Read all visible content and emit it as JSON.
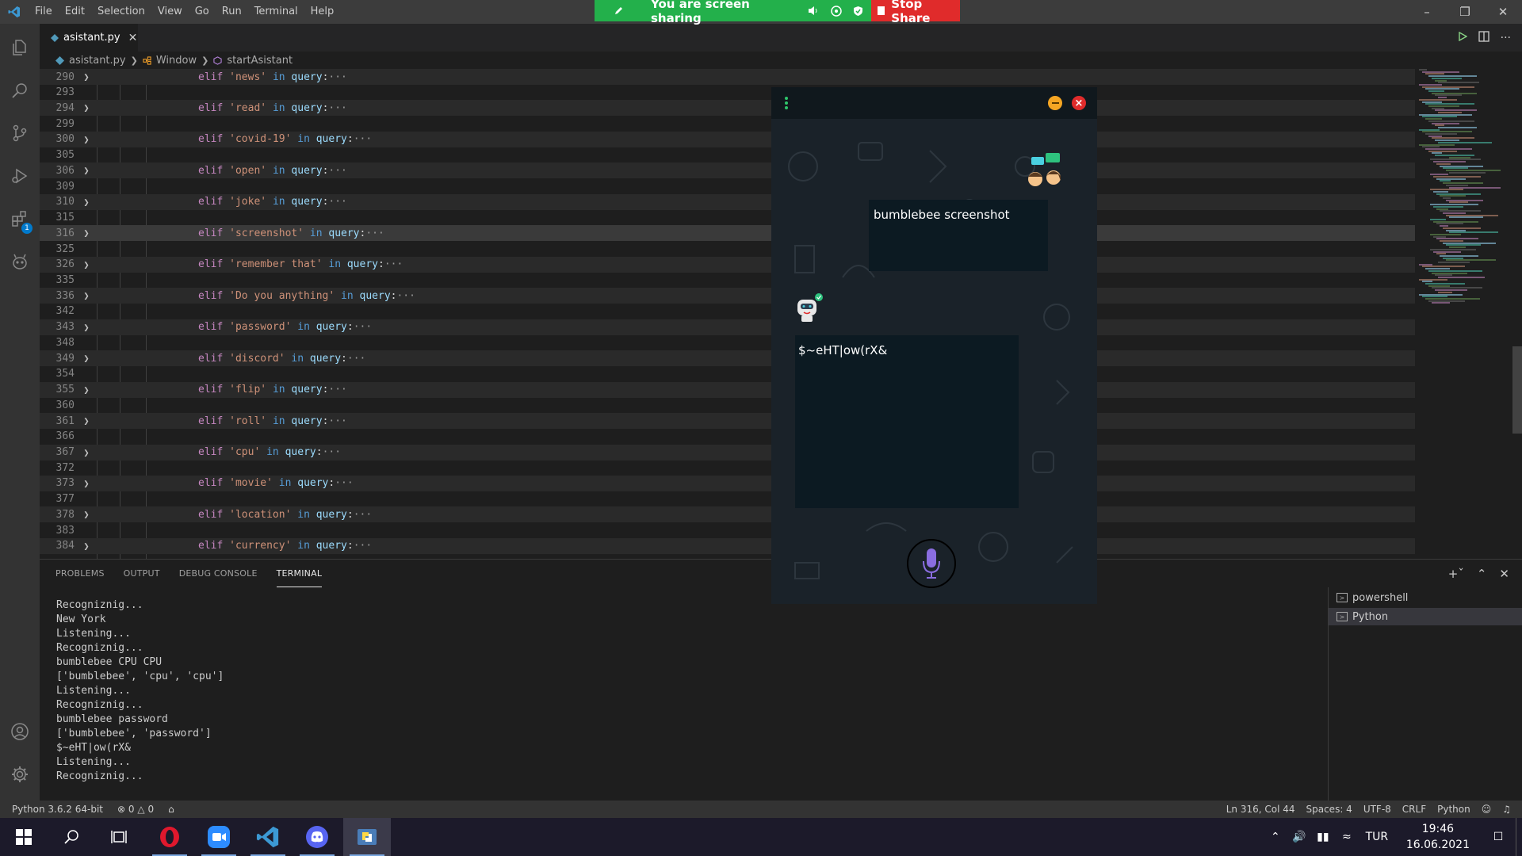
{
  "menu": [
    "File",
    "Edit",
    "Selection",
    "View",
    "Go",
    "Run",
    "Terminal",
    "Help"
  ],
  "share": {
    "message": "You are screen sharing",
    "stop_label": "Stop Share"
  },
  "tab": {
    "filename": "asistant.py"
  },
  "breadcrumb": {
    "file": "asistant.py",
    "class": "Window",
    "method": "startAsistant"
  },
  "activity": {
    "extensions_badge": "1"
  },
  "editor": {
    "lines": [
      {
        "n": "290",
        "fold": true,
        "kw": "elif",
        "str": "'news'",
        "in": "in",
        "var": "query",
        "rest": ":",
        "ell": "···"
      },
      {
        "n": "293"
      },
      {
        "n": "294",
        "fold": true,
        "kw": "elif",
        "str": "'read'",
        "in": "in",
        "var": "query",
        "rest": ":",
        "ell": "···"
      },
      {
        "n": "299"
      },
      {
        "n": "300",
        "fold": true,
        "kw": "elif",
        "str": "'covid-19'",
        "in": "in",
        "var": "query",
        "rest": ":",
        "ell": "···"
      },
      {
        "n": "305"
      },
      {
        "n": "306",
        "fold": true,
        "kw": "elif",
        "str": "'open'",
        "in": "in",
        "var": "query",
        "rest": ":",
        "ell": "···"
      },
      {
        "n": "309"
      },
      {
        "n": "310",
        "fold": true,
        "kw": "elif",
        "str": "'joke'",
        "in": "in",
        "var": "query",
        "rest": ":",
        "ell": "···"
      },
      {
        "n": "315"
      },
      {
        "n": "316",
        "fold": true,
        "current": true,
        "kw": "elif",
        "str": "'screenshot'",
        "in": "in",
        "var": "query",
        "rest": ":",
        "ell": "···"
      },
      {
        "n": "325"
      },
      {
        "n": "326",
        "fold": true,
        "kw": "elif",
        "str": "'remember that'",
        "in": "in",
        "var": "query",
        "rest": ":",
        "ell": "···"
      },
      {
        "n": "335"
      },
      {
        "n": "336",
        "fold": true,
        "kw": "elif",
        "str": "'Do you anything'",
        "in": "in",
        "var": "query",
        "rest": ":",
        "ell": "···"
      },
      {
        "n": "342"
      },
      {
        "n": "343",
        "fold": true,
        "kw": "elif",
        "str": "'password'",
        "in": "in",
        "var": "query",
        "rest": ":",
        "ell": "···"
      },
      {
        "n": "348"
      },
      {
        "n": "349",
        "fold": true,
        "kw": "elif",
        "str": "'discord'",
        "in": "in",
        "var": "query",
        "rest": ":",
        "ell": "···"
      },
      {
        "n": "354"
      },
      {
        "n": "355",
        "fold": true,
        "kw": "elif",
        "str": "'flip'",
        "in": "in",
        "var": "query",
        "rest": ":",
        "ell": "···"
      },
      {
        "n": "360"
      },
      {
        "n": "361",
        "fold": true,
        "kw": "elif",
        "str": "'roll'",
        "in": "in",
        "var": "query",
        "rest": ":",
        "ell": "···"
      },
      {
        "n": "366"
      },
      {
        "n": "367",
        "fold": true,
        "kw": "elif",
        "str": "'cpu'",
        "in": "in",
        "var": "query",
        "rest": ":",
        "ell": "···"
      },
      {
        "n": "372"
      },
      {
        "n": "373",
        "fold": true,
        "kw": "elif",
        "str": "'movie'",
        "in": "in",
        "var": "query",
        "rest": ":",
        "ell": "···"
      },
      {
        "n": "377"
      },
      {
        "n": "378",
        "fold": true,
        "kw": "elif",
        "str": "'location'",
        "in": "in",
        "var": "query",
        "rest": ":",
        "ell": "···"
      },
      {
        "n": "383"
      },
      {
        "n": "384",
        "fold": true,
        "kw": "elif",
        "str": "'currency'",
        "in": "in",
        "var": "query",
        "rest": ":",
        "ell": "···"
      }
    ]
  },
  "panel": {
    "tabs": [
      "PROBLEMS",
      "OUTPUT",
      "DEBUG CONSOLE",
      "TERMINAL"
    ],
    "terminal_output": "Recogniznig...\nNew York\nListening...\nRecogniznig...\nbumblebee CPU CPU\n['bumblebee', 'cpu', 'cpu']\nListening...\nRecogniznig...\nbumblebee password\n['bumblebee', 'password']\n$~eHT|ow(rX&\nListening...\nRecogniznig...",
    "terminals": [
      "powershell",
      "Python"
    ]
  },
  "assistant": {
    "user_message": "bumblebee screenshot",
    "bot_message": "$~eHT|ow(rX&"
  },
  "status": {
    "interpreter": "Python 3.6.2 64-bit",
    "errors": "0",
    "warnings": "0",
    "position": "Ln 316, Col 44",
    "spaces": "Spaces: 4",
    "encoding": "UTF-8",
    "eol": "CRLF",
    "language": "Python"
  },
  "taskbar": {
    "language": "TUR",
    "time": "19:46",
    "date": "16.06.2021"
  },
  "colors": {
    "accent": "#007acc",
    "share_green": "#23b04b",
    "stop_red": "#e02b2b"
  }
}
